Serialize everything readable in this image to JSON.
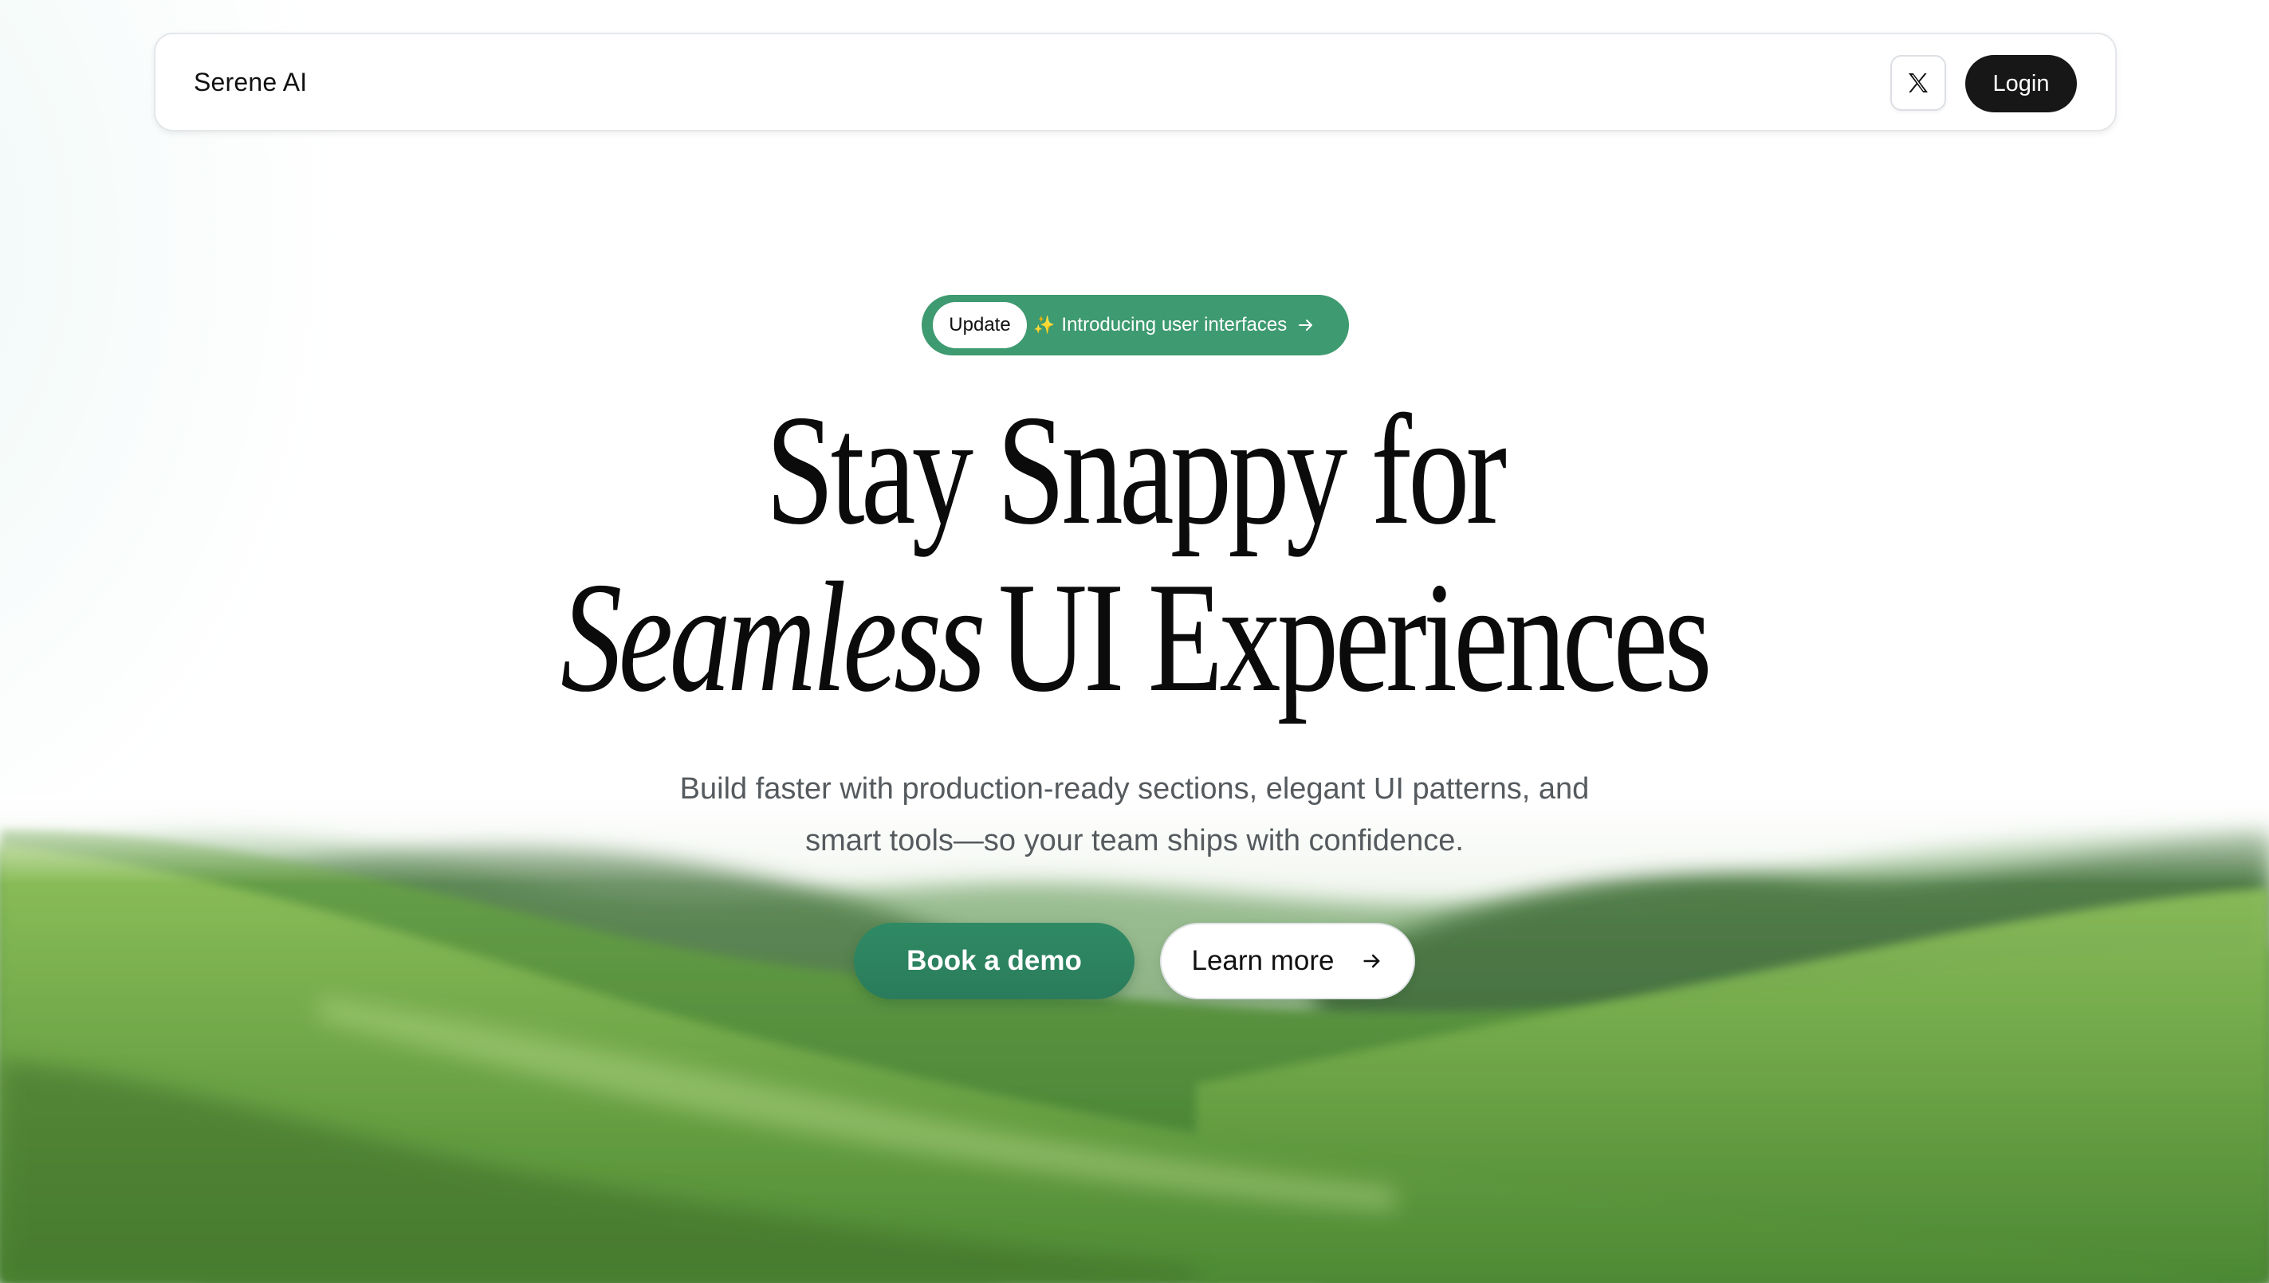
{
  "header": {
    "brand": "Serene AI",
    "x_icon": "x-logo-icon",
    "login_label": "Login"
  },
  "announcement": {
    "tag": "Update",
    "text": "Introducing user interfaces",
    "icon_left": "sparkles-icon",
    "icon_right": "arrow-right-icon"
  },
  "hero": {
    "title_line1": "Stay Snappy for",
    "title_line2_italic": "Seamless",
    "title_line2_rest": "UI Experiences",
    "subtitle_line1": "Build faster with production-ready sections, elegant UI patterns, and",
    "subtitle_line2": "smart tools—so your team ships with confidence."
  },
  "cta": {
    "primary_label": "Book a demo",
    "secondary_label": "Learn more",
    "secondary_icon": "arrow-right-icon"
  },
  "colors": {
    "accent_green": "#3e9a70",
    "button_green": "#2a7c5b",
    "dark_button": "#171717",
    "sparkle": "#f3d16b"
  }
}
